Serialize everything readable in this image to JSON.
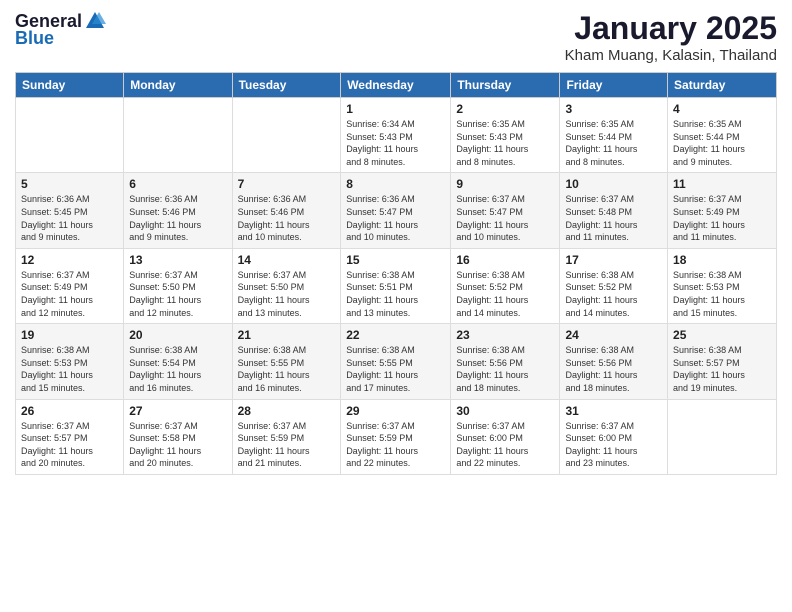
{
  "header": {
    "logo_general": "General",
    "logo_blue": "Blue",
    "month_title": "January 2025",
    "location": "Kham Muang, Kalasin, Thailand"
  },
  "weekdays": [
    "Sunday",
    "Monday",
    "Tuesday",
    "Wednesday",
    "Thursday",
    "Friday",
    "Saturday"
  ],
  "weeks": [
    {
      "shade": false,
      "days": [
        {
          "num": "",
          "info": ""
        },
        {
          "num": "",
          "info": ""
        },
        {
          "num": "",
          "info": ""
        },
        {
          "num": "1",
          "info": "Sunrise: 6:34 AM\nSunset: 5:43 PM\nDaylight: 11 hours\nand 8 minutes."
        },
        {
          "num": "2",
          "info": "Sunrise: 6:35 AM\nSunset: 5:43 PM\nDaylight: 11 hours\nand 8 minutes."
        },
        {
          "num": "3",
          "info": "Sunrise: 6:35 AM\nSunset: 5:44 PM\nDaylight: 11 hours\nand 8 minutes."
        },
        {
          "num": "4",
          "info": "Sunrise: 6:35 AM\nSunset: 5:44 PM\nDaylight: 11 hours\nand 9 minutes."
        }
      ]
    },
    {
      "shade": true,
      "days": [
        {
          "num": "5",
          "info": "Sunrise: 6:36 AM\nSunset: 5:45 PM\nDaylight: 11 hours\nand 9 minutes."
        },
        {
          "num": "6",
          "info": "Sunrise: 6:36 AM\nSunset: 5:46 PM\nDaylight: 11 hours\nand 9 minutes."
        },
        {
          "num": "7",
          "info": "Sunrise: 6:36 AM\nSunset: 5:46 PM\nDaylight: 11 hours\nand 10 minutes."
        },
        {
          "num": "8",
          "info": "Sunrise: 6:36 AM\nSunset: 5:47 PM\nDaylight: 11 hours\nand 10 minutes."
        },
        {
          "num": "9",
          "info": "Sunrise: 6:37 AM\nSunset: 5:47 PM\nDaylight: 11 hours\nand 10 minutes."
        },
        {
          "num": "10",
          "info": "Sunrise: 6:37 AM\nSunset: 5:48 PM\nDaylight: 11 hours\nand 11 minutes."
        },
        {
          "num": "11",
          "info": "Sunrise: 6:37 AM\nSunset: 5:49 PM\nDaylight: 11 hours\nand 11 minutes."
        }
      ]
    },
    {
      "shade": false,
      "days": [
        {
          "num": "12",
          "info": "Sunrise: 6:37 AM\nSunset: 5:49 PM\nDaylight: 11 hours\nand 12 minutes."
        },
        {
          "num": "13",
          "info": "Sunrise: 6:37 AM\nSunset: 5:50 PM\nDaylight: 11 hours\nand 12 minutes."
        },
        {
          "num": "14",
          "info": "Sunrise: 6:37 AM\nSunset: 5:50 PM\nDaylight: 11 hours\nand 13 minutes."
        },
        {
          "num": "15",
          "info": "Sunrise: 6:38 AM\nSunset: 5:51 PM\nDaylight: 11 hours\nand 13 minutes."
        },
        {
          "num": "16",
          "info": "Sunrise: 6:38 AM\nSunset: 5:52 PM\nDaylight: 11 hours\nand 14 minutes."
        },
        {
          "num": "17",
          "info": "Sunrise: 6:38 AM\nSunset: 5:52 PM\nDaylight: 11 hours\nand 14 minutes."
        },
        {
          "num": "18",
          "info": "Sunrise: 6:38 AM\nSunset: 5:53 PM\nDaylight: 11 hours\nand 15 minutes."
        }
      ]
    },
    {
      "shade": true,
      "days": [
        {
          "num": "19",
          "info": "Sunrise: 6:38 AM\nSunset: 5:53 PM\nDaylight: 11 hours\nand 15 minutes."
        },
        {
          "num": "20",
          "info": "Sunrise: 6:38 AM\nSunset: 5:54 PM\nDaylight: 11 hours\nand 16 minutes."
        },
        {
          "num": "21",
          "info": "Sunrise: 6:38 AM\nSunset: 5:55 PM\nDaylight: 11 hours\nand 16 minutes."
        },
        {
          "num": "22",
          "info": "Sunrise: 6:38 AM\nSunset: 5:55 PM\nDaylight: 11 hours\nand 17 minutes."
        },
        {
          "num": "23",
          "info": "Sunrise: 6:38 AM\nSunset: 5:56 PM\nDaylight: 11 hours\nand 18 minutes."
        },
        {
          "num": "24",
          "info": "Sunrise: 6:38 AM\nSunset: 5:56 PM\nDaylight: 11 hours\nand 18 minutes."
        },
        {
          "num": "25",
          "info": "Sunrise: 6:38 AM\nSunset: 5:57 PM\nDaylight: 11 hours\nand 19 minutes."
        }
      ]
    },
    {
      "shade": false,
      "days": [
        {
          "num": "26",
          "info": "Sunrise: 6:37 AM\nSunset: 5:57 PM\nDaylight: 11 hours\nand 20 minutes."
        },
        {
          "num": "27",
          "info": "Sunrise: 6:37 AM\nSunset: 5:58 PM\nDaylight: 11 hours\nand 20 minutes."
        },
        {
          "num": "28",
          "info": "Sunrise: 6:37 AM\nSunset: 5:59 PM\nDaylight: 11 hours\nand 21 minutes."
        },
        {
          "num": "29",
          "info": "Sunrise: 6:37 AM\nSunset: 5:59 PM\nDaylight: 11 hours\nand 22 minutes."
        },
        {
          "num": "30",
          "info": "Sunrise: 6:37 AM\nSunset: 6:00 PM\nDaylight: 11 hours\nand 22 minutes."
        },
        {
          "num": "31",
          "info": "Sunrise: 6:37 AM\nSunset: 6:00 PM\nDaylight: 11 hours\nand 23 minutes."
        },
        {
          "num": "",
          "info": ""
        }
      ]
    }
  ]
}
